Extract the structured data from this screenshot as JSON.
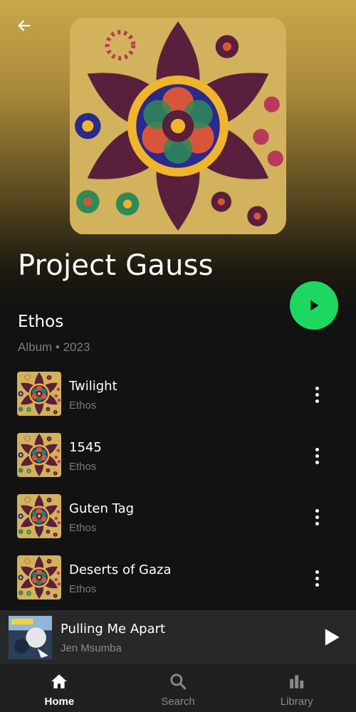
{
  "header": {
    "back_icon": "arrow-left-icon"
  },
  "artist": {
    "name": "Project Gauss"
  },
  "album": {
    "title": "Ethos",
    "meta": "Album • 2023",
    "cover_description_colors": [
      "#c9a84a",
      "#5a1f3d",
      "#2a2a8e",
      "#f0b52a",
      "#2e8b57",
      "#d9553a"
    ]
  },
  "colors": {
    "accent": "#1ed760",
    "background": "#121212",
    "secondary_text": "#7a7a7a"
  },
  "tracks": [
    {
      "title": "Twilight",
      "album": "Ethos"
    },
    {
      "title": "1545",
      "album": "Ethos"
    },
    {
      "title": "Guten Tag",
      "album": "Ethos"
    },
    {
      "title": "Deserts of Gaza",
      "album": "Ethos"
    }
  ],
  "now_playing": {
    "title": "Pulling Me Apart",
    "artist": "Jen Msumba"
  },
  "nav": [
    {
      "label": "Home",
      "icon": "home-icon",
      "active": true
    },
    {
      "label": "Search",
      "icon": "search-icon",
      "active": false
    },
    {
      "label": "Library",
      "icon": "library-icon",
      "active": false
    }
  ]
}
